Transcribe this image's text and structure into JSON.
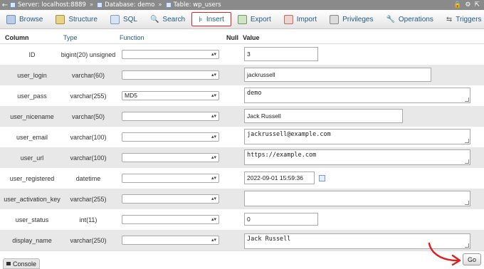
{
  "breadcrumb": {
    "server": "Server: localhost:8889",
    "database": "Database: demo",
    "table": "Table: wp_users",
    "separator": "»"
  },
  "tabs": [
    {
      "label": "Browse",
      "icon": "browse-icon"
    },
    {
      "label": "Structure",
      "icon": "structure-icon"
    },
    {
      "label": "SQL",
      "icon": "sql-icon"
    },
    {
      "label": "Search",
      "icon": "search-icon"
    },
    {
      "label": "Insert",
      "icon": "insert-icon",
      "active": true
    },
    {
      "label": "Export",
      "icon": "export-icon"
    },
    {
      "label": "Import",
      "icon": "import-icon"
    },
    {
      "label": "Privileges",
      "icon": "privileges-icon"
    },
    {
      "label": "Operations",
      "icon": "operations-icon"
    },
    {
      "label": "Triggers",
      "icon": "triggers-icon"
    }
  ],
  "table_header": {
    "column": "Column",
    "type": "Type",
    "function": "Function",
    "null": "Null",
    "value": "Value"
  },
  "rows": [
    {
      "column": "ID",
      "type": "bigint(20) unsigned",
      "function": "",
      "value": "3"
    },
    {
      "column": "user_login",
      "type": "varchar(60)",
      "function": "",
      "value": "jackrussell"
    },
    {
      "column": "user_pass",
      "type": "varchar(255)",
      "function": "MD5",
      "value": "demo"
    },
    {
      "column": "user_nicename",
      "type": "varchar(50)",
      "function": "",
      "value": "Jack Russell"
    },
    {
      "column": "user_email",
      "type": "varchar(100)",
      "function": "",
      "value": "jackrussell@example.com"
    },
    {
      "column": "user_url",
      "type": "varchar(100)",
      "function": "",
      "value": "https://example.com"
    },
    {
      "column": "user_registered",
      "type": "datetime",
      "function": "",
      "value": "2022-09-01 15:59:36"
    },
    {
      "column": "user_activation_key",
      "type": "varchar(255)",
      "function": "",
      "value": ""
    },
    {
      "column": "user_status",
      "type": "int(11)",
      "function": "",
      "value": "0"
    },
    {
      "column": "display_name",
      "type": "varchar(250)",
      "function": "",
      "value": "Jack Russell"
    }
  ],
  "console_label": "Console",
  "go_label": "Go",
  "colors": {
    "active_tab_border": "#d8262c",
    "link": "#235a81",
    "annotation_arrow": "#e01e1e",
    "alt_row": "#e8e8e8"
  }
}
